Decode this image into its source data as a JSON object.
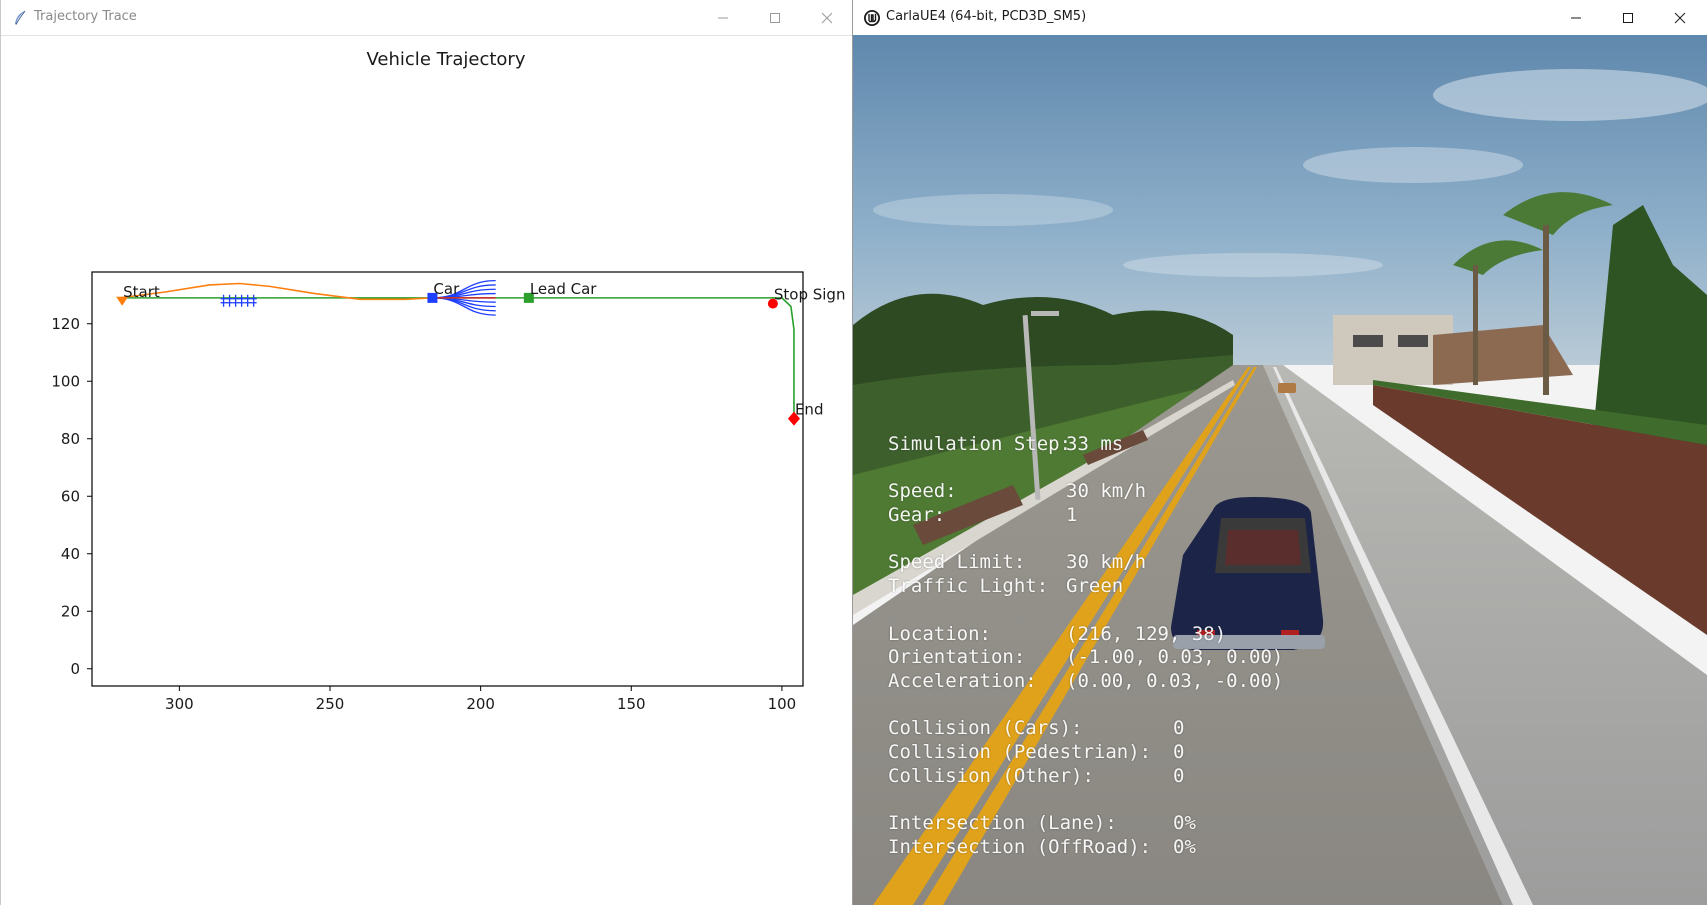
{
  "left_window": {
    "title": "Trajectory Trace",
    "icon": "feather-icon",
    "controls": [
      "minimize-icon",
      "maximize-icon",
      "close-icon"
    ]
  },
  "right_window": {
    "title": "CarlaUE4 (64-bit, PCD3D_SM5)",
    "icon": "unreal-engine-icon",
    "controls": [
      "minimize-icon",
      "maximize-icon",
      "close-icon"
    ]
  },
  "chart_data": {
    "type": "line",
    "title": "Vehicle Trajectory",
    "xlabel": "",
    "ylabel": "",
    "xlim": [
      329,
      93
    ],
    "ylim": [
      -6,
      138
    ],
    "x_ticks": [
      300,
      250,
      200,
      150,
      100
    ],
    "y_ticks": [
      0,
      20,
      40,
      60,
      80,
      100,
      120
    ],
    "grid": false,
    "series": [
      {
        "color": "#2ca02c",
        "marker": "none",
        "x": [
          320,
          280,
          240,
          216,
          200,
          184,
          150,
          104,
          100,
          97,
          96,
          96,
          96
        ],
        "y": [
          129,
          129,
          129,
          129,
          129,
          129,
          129,
          129,
          129,
          126,
          118,
          100,
          87
        ]
      },
      {
        "color": "#ff7f0e",
        "marker": "none",
        "x": [
          320,
          305,
          290,
          280,
          270,
          255,
          240,
          225,
          216
        ],
        "y": [
          129,
          131,
          133.5,
          134,
          133,
          130.5,
          128.5,
          128.5,
          129
        ]
      }
    ],
    "lookahead_paths": {
      "color": "#1f3fff",
      "origin": [
        216,
        129
      ],
      "end_x": 195,
      "end_y": [
        123,
        124.5,
        126,
        127.5,
        129,
        130.5,
        132,
        133.5,
        135
      ]
    },
    "best_path": {
      "color": "#d62728",
      "x": [
        216,
        195
      ],
      "y": [
        129,
        129
      ]
    },
    "markers": [
      {
        "label": "Start",
        "x": 319,
        "y": 128,
        "shape": "triangle-down",
        "color": "#ff7f0e"
      },
      {
        "label": "Car",
        "x": 216,
        "y": 129,
        "shape": "square",
        "color": "#1f3fff"
      },
      {
        "label": "Lead Car",
        "x": 184,
        "y": 129,
        "shape": "square",
        "color": "#2ca02c"
      },
      {
        "label": "Stop Sign",
        "x": 103,
        "y": 127,
        "shape": "circle",
        "color": "#ff0000"
      },
      {
        "label": "End",
        "x": 96,
        "y": 87,
        "shape": "diamond",
        "color": "#ff0000"
      }
    ],
    "obstacles": {
      "shape": "x-cross",
      "color": "#1f3fff",
      "x": [
        284,
        280,
        276
      ],
      "y": [
        128,
        128,
        128
      ]
    }
  },
  "hud": {
    "color": "#ffffff",
    "rows": [
      {
        "label": "Simulation Step:",
        "value": "33 ms"
      },
      null,
      {
        "label": "Speed:",
        "value": "30 km/h"
      },
      {
        "label": "Gear:",
        "value": "1"
      },
      null,
      {
        "label": "Speed Limit:",
        "value": "30 km/h"
      },
      {
        "label": "Traffic Light:",
        "value": "Green"
      },
      null,
      {
        "label": "Location:",
        "value": "(216, 129, 38)"
      },
      {
        "label": "Orientation:",
        "value": "(-1.00, 0.03, 0.00)"
      },
      {
        "label": "Acceleration:",
        "value": "(0.00, 0.03, -0.00)"
      },
      null,
      {
        "label": "Collision (Cars):",
        "value": "0"
      },
      {
        "label": "Collision (Pedestrian):",
        "value": "0"
      },
      {
        "label": "Collision (Other):",
        "value": "0"
      },
      null,
      {
        "label": "Intersection (Lane):",
        "value": "0%"
      },
      {
        "label": "Intersection (OffRoad):",
        "value": "0%"
      }
    ]
  }
}
